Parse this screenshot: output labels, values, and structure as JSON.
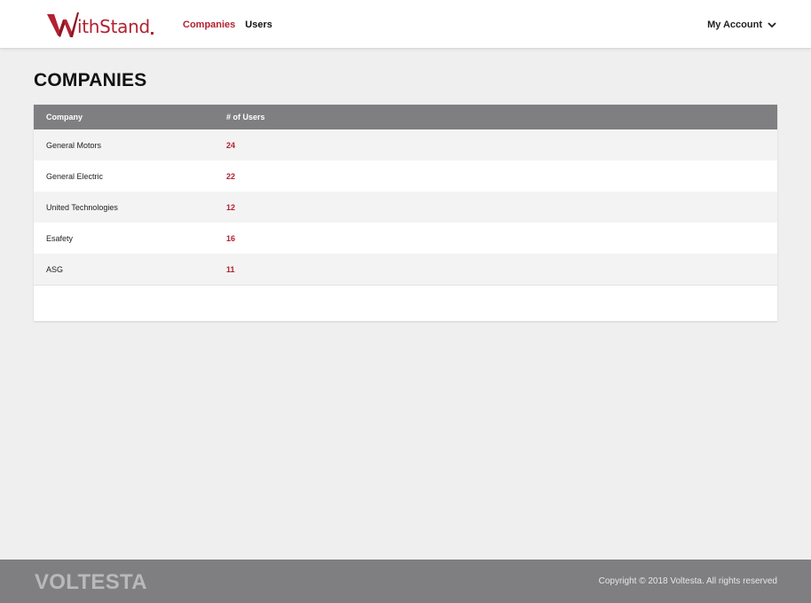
{
  "header": {
    "logo_text": "ithStand",
    "nav": [
      {
        "label": "Companies",
        "active": true
      },
      {
        "label": "Users",
        "active": false
      }
    ],
    "account_label": "My Account",
    "account_icon": "chevron-down-icon"
  },
  "page": {
    "title": "COMPANIES"
  },
  "table": {
    "columns": [
      "Company",
      "# of Users"
    ],
    "rows": [
      {
        "company": "General Motors",
        "users": "24"
      },
      {
        "company": "General Electric",
        "users": "22"
      },
      {
        "company": "United Technologies",
        "users": "12"
      },
      {
        "company": "Esafety",
        "users": "16"
      },
      {
        "company": "ASG",
        "users": "11"
      }
    ]
  },
  "footer": {
    "brand": "VOLTESTA",
    "copyright": "Copyright © 2018 Voltesta. All rights reserved"
  },
  "colors": {
    "accent": "#b32130",
    "header_bg": "#ffffff",
    "table_header_bg": "#7f7f81",
    "footer_bg": "#7f7f81",
    "page_bg": "#efefef"
  }
}
